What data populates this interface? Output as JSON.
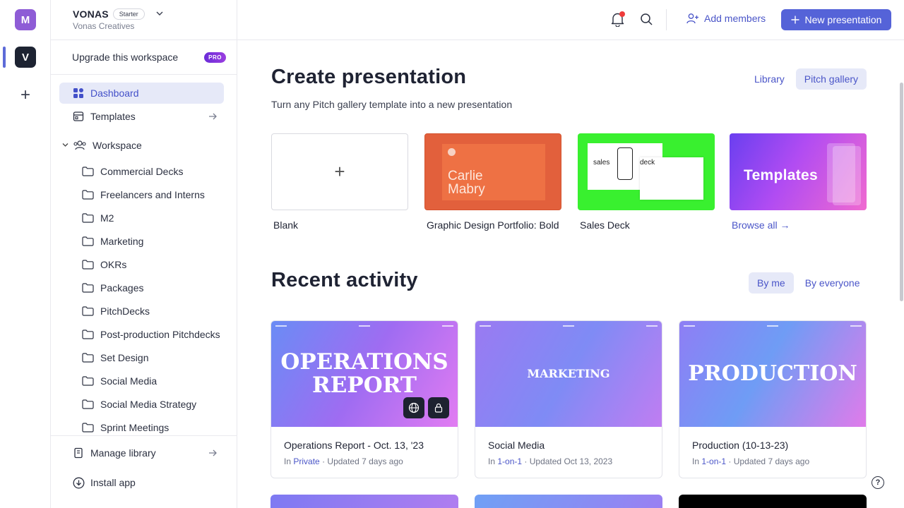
{
  "rail": {
    "workspaces": [
      {
        "initial": "M",
        "color": "#8e5cd6"
      },
      {
        "initial": "V",
        "color": "#1d2332"
      }
    ],
    "add_glyph": "+"
  },
  "workspace": {
    "name": "VONAS",
    "plan_badge": "Starter",
    "subtitle": "Vonas Creatives"
  },
  "sidebar": {
    "upgrade_label": "Upgrade this workspace",
    "pro_badge": "PRO",
    "nav": [
      {
        "label": "Dashboard",
        "icon": "dashboard-icon"
      },
      {
        "label": "Templates",
        "icon": "templates-icon"
      }
    ],
    "workspace_section": "Workspace",
    "folders": [
      "Commercial Decks",
      "Freelancers and Interns",
      "M2",
      "Marketing",
      "OKRs",
      "Packages",
      "PitchDecks",
      "Post-production Pitchdecks",
      "Set Design",
      "Social Media",
      "Social Media Strategy",
      "Sprint Meetings"
    ],
    "manage_library": "Manage library",
    "install_app": "Install app"
  },
  "topbar": {
    "add_members": "Add members",
    "new_presentation": "New presentation",
    "accent": "#5563d8"
  },
  "create": {
    "title": "Create presentation",
    "subtitle": "Turn any Pitch gallery template into a new presentation",
    "tabs": [
      "Library",
      "Pitch gallery"
    ],
    "active_tab": "Pitch gallery",
    "templates": [
      {
        "label": "Blank",
        "thumb_text": "+"
      },
      {
        "label": "Graphic Design Portfolio: Bold",
        "thumb_text_1": "Carlie",
        "thumb_text_2": "Mabry"
      },
      {
        "label": "Sales Deck",
        "thumb_text_1": "sales",
        "thumb_text_2": "deck"
      },
      {
        "label": "Browse all →",
        "thumb_text": "Templates"
      }
    ]
  },
  "recent": {
    "title": "Recent activity",
    "tabs": [
      "By me",
      "By everyone"
    ],
    "active_tab": "By me",
    "cards": [
      {
        "thumb_title": "OPERATIONS REPORT",
        "title": "Operations Report - Oct. 13, '23",
        "in": "In",
        "location": "Private",
        "updated": "Updated 7 days ago"
      },
      {
        "thumb_title": "MARKETING",
        "title": "Social Media",
        "in": "In",
        "location": "1-on-1",
        "updated": "Updated Oct 13, 2023"
      },
      {
        "thumb_title": "PRODUCTION",
        "title": "Production (10-13-23)",
        "in": "In",
        "location": "1-on-1",
        "updated": "Updated 7 days ago"
      }
    ]
  },
  "help_label": "?"
}
